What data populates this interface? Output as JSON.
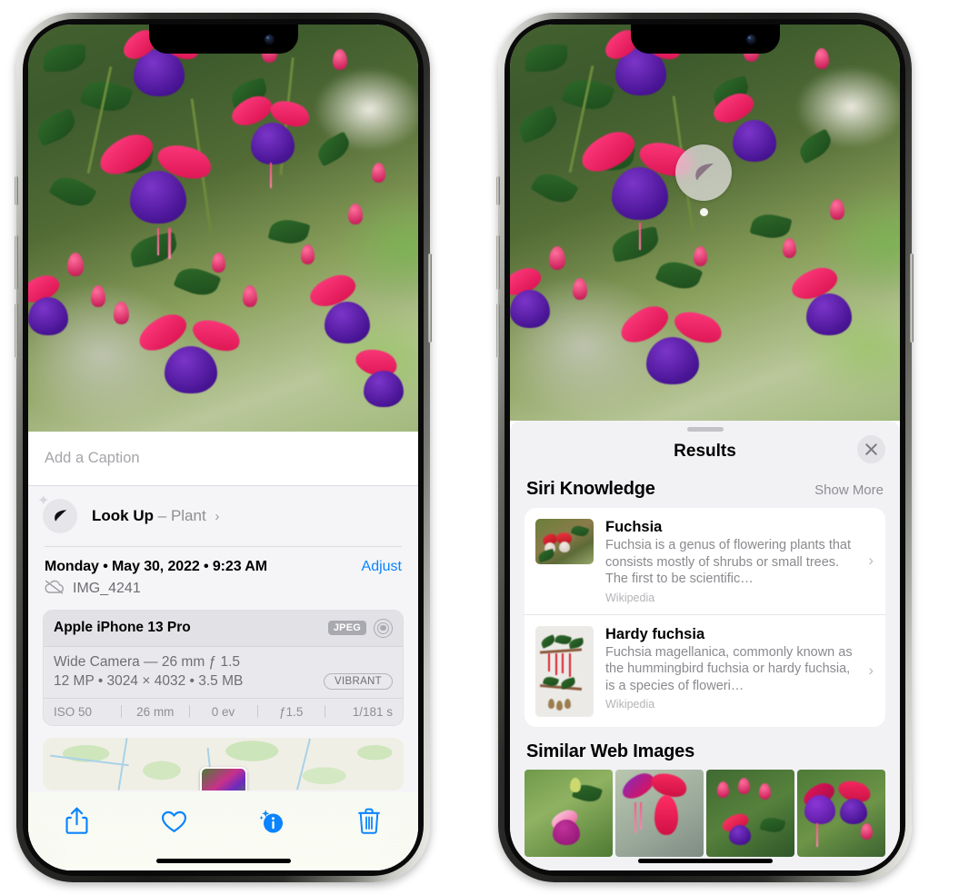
{
  "left_phone": {
    "photo": {
      "subject": "fuchsia-flowers-hanging-basket"
    },
    "caption_field": {
      "placeholder": "Add a Caption",
      "value": ""
    },
    "look_up": {
      "icon": "leaf-icon",
      "label": "Look Up",
      "dash": "–",
      "subject": "Plant",
      "chevron": "›"
    },
    "date_row": {
      "date": "Monday • May 30, 2022 • 9:23 AM",
      "adjust_label": "Adjust"
    },
    "file_row": {
      "icon": "cloud-slash-icon",
      "filename": "IMG_4241"
    },
    "metadata": {
      "device": "Apple iPhone 13 Pro",
      "format_badge": "JPEG",
      "aperture_icon": "aperture-icon",
      "lens_line": "Wide Camera — 26 mm ƒ 1.5",
      "specs_line": "12 MP • 3024 × 4032 • 3.5 MB",
      "style_badge": "VIBRANT",
      "exif": [
        "ISO 50",
        "26 mm",
        "0 ev",
        "ƒ1.5",
        "1/181 s"
      ]
    },
    "map": {
      "pin": "photo-pin"
    },
    "toolbar": [
      {
        "name": "share-icon",
        "label": "Share"
      },
      {
        "name": "heart-icon",
        "label": "Favorite"
      },
      {
        "name": "info-sparkle-icon",
        "label": "Info"
      },
      {
        "name": "trash-icon",
        "label": "Delete"
      }
    ]
  },
  "right_phone": {
    "photo": {
      "subject": "fuchsia-flowers-hanging-basket"
    },
    "visual_lookup_badge": {
      "icon": "leaf-icon"
    },
    "sheet": {
      "title": "Results",
      "close_label": "✕",
      "siri_knowledge": {
        "title": "Siri Knowledge",
        "show_more": "Show More",
        "cards": [
          {
            "title": "Fuchsia",
            "description": "Fuchsia is a genus of flowering plants that consists mostly of shrubs or small trees. The first to be scientific…",
            "source": "Wikipedia",
            "chevron": "›"
          },
          {
            "title": "Hardy fuchsia",
            "description": "Fuchsia magellanica, commonly known as the hummingbird fuchsia or hardy fuchsia, is a species of floweri…",
            "source": "Wikipedia",
            "chevron": "›"
          }
        ]
      },
      "similar_web_images": {
        "title": "Similar Web Images",
        "thumbnails": [
          "web-image-1",
          "web-image-2",
          "web-image-3",
          "web-image-4"
        ]
      }
    }
  },
  "colors": {
    "accent_blue": "#0a84ff",
    "sheet_background": "#f5f5f7",
    "results_background": "#f2f2f5",
    "card_white": "#ffffff",
    "secondary_text": "#8e8e93",
    "badge_gray": "#a9a9b0"
  }
}
